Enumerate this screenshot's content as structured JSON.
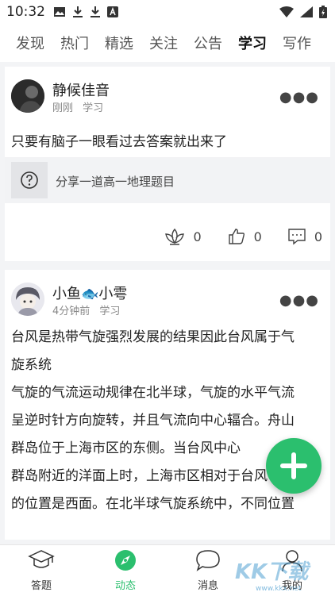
{
  "status_bar": {
    "time": "10:32"
  },
  "tabs": [
    "发现",
    "热门",
    "精选",
    "关注",
    "公告",
    "学习",
    "写作"
  ],
  "active_tab": "学习",
  "posts": [
    {
      "author": "静候佳音",
      "time_ago": "刚刚",
      "category": "学习",
      "text": "只要有脑子一眼看过去答案就出来了",
      "question_label": "分享一道高一地理题目",
      "likes": "0",
      "thumbs": "0",
      "comments": "0"
    },
    {
      "author": "小鱼🐟小雩",
      "time_ago": "4分钟前",
      "category": "学习",
      "lines": [
        "台风是热带气旋强烈发展的结果因此台风属于气",
        "旋系统",
        "气旋的气流运动规律在北半球，气旋的水平气流",
        "呈逆时针方向旋转，并且气流向中心辐合。舟山",
        "群岛位于上海市区的东侧。当台风中心",
        "群岛附近的洋面上时，上海市区相对于台风中心",
        "的位置是西面。在北半球气旋系统中，不同位置"
      ]
    }
  ],
  "bottom_nav": [
    {
      "label": "答题",
      "icon": "graduation-cap-icon"
    },
    {
      "label": "动态",
      "icon": "compass-icon"
    },
    {
      "label": "消息",
      "icon": "chat-bubble-icon"
    },
    {
      "label": "我的",
      "icon": "person-icon"
    }
  ],
  "active_nav": "动态",
  "watermark": {
    "logo": "KK下载",
    "url": "www.kkx.net"
  },
  "colors": {
    "accent": "#2bbf6e",
    "background": "#f3f4f6"
  }
}
